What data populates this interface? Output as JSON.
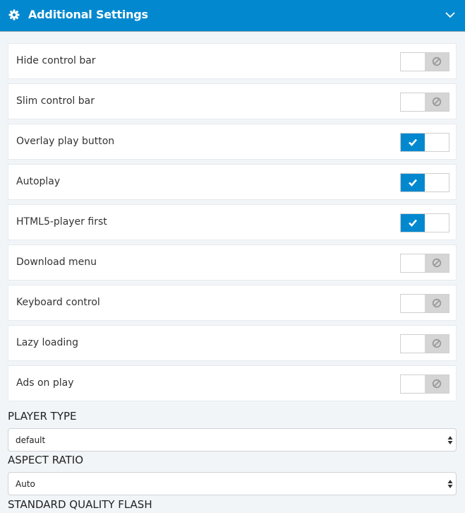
{
  "header": {
    "title": "Additional Settings",
    "icon": "gear-icon",
    "collapse_icon": "chevron-down-icon"
  },
  "toggles": [
    {
      "label": "Hide control bar",
      "state": "off"
    },
    {
      "label": "Slim control bar",
      "state": "off"
    },
    {
      "label": "Overlay play button",
      "state": "on"
    },
    {
      "label": "Autoplay",
      "state": "on"
    },
    {
      "label": "HTML5-player first",
      "state": "on"
    },
    {
      "label": "Download menu",
      "state": "off"
    },
    {
      "label": "Keyboard control",
      "state": "off"
    },
    {
      "label": "Lazy loading",
      "state": "off"
    },
    {
      "label": "Ads on play",
      "state": "off"
    }
  ],
  "player_type": {
    "label": "PLAYER TYPE",
    "value": "default"
  },
  "aspect_ratio": {
    "label": "ASPECT RATIO",
    "value": "Auto"
  },
  "standard_quality_flash": {
    "label": "STANDARD QUALITY FLASH"
  },
  "colors": {
    "accent": "#0288cf",
    "off_bg": "#d5d5d5",
    "page_bg": "#f2f5f8"
  }
}
